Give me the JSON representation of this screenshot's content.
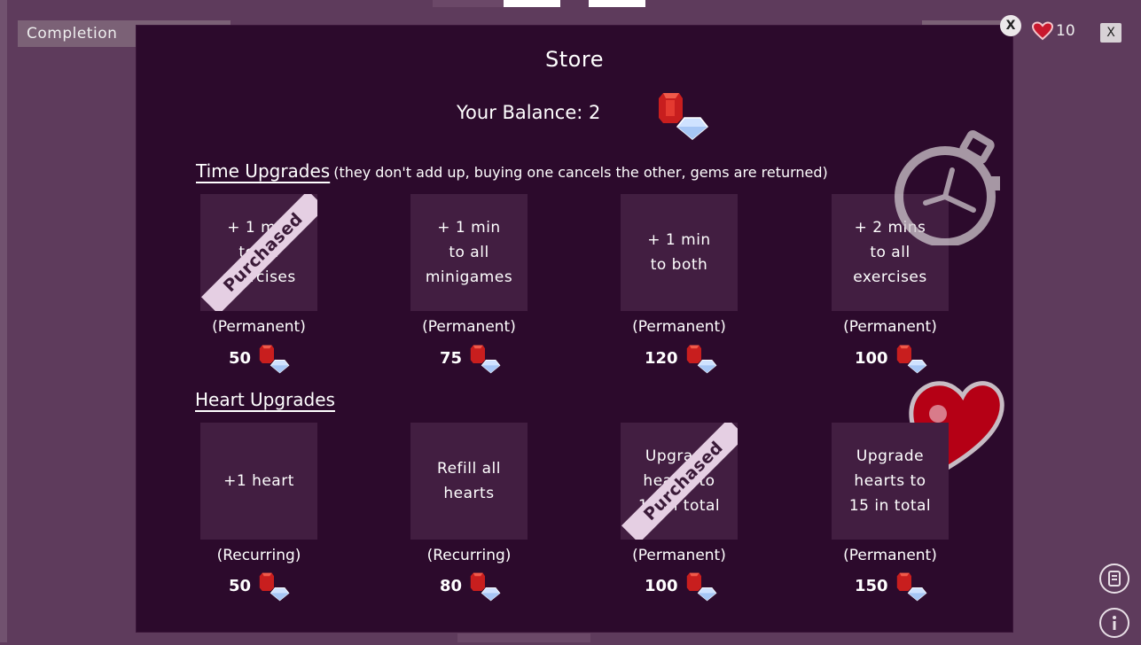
{
  "top_bar": {
    "completion_label": "Completion",
    "hearts_count": "10",
    "close_label": "X"
  },
  "store": {
    "close_label": "X",
    "title": "Store",
    "balance_label": "Your Balance: 2",
    "purchased_label": "Purchased",
    "time_section": {
      "title": "Time Upgrades",
      "note": "(they don't add up, buying one cancels the other, gems are returned)",
      "items": [
        {
          "label": "+ 1 min\nto all\nexercises",
          "type": "(Permanent)",
          "price": "50",
          "purchased": true
        },
        {
          "label": "+ 1 min\nto all\nminigames",
          "type": "(Permanent)",
          "price": "75",
          "purchased": false
        },
        {
          "label": "+ 1 min\nto both",
          "type": "(Permanent)",
          "price": "120",
          "purchased": false
        },
        {
          "label": "+ 2 mins\nto all\nexercises",
          "type": "(Permanent)",
          "price": "100",
          "purchased": false
        }
      ]
    },
    "heart_section": {
      "title": "Heart Upgrades",
      "items": [
        {
          "label": "+1 heart",
          "type": "(Recurring)",
          "price": "50",
          "purchased": false
        },
        {
          "label": "Refill all\nhearts",
          "type": "(Recurring)",
          "price": "80",
          "purchased": false
        },
        {
          "label": "Upgrade\nhearts to\n10 in total",
          "type": "(Permanent)",
          "price": "100",
          "purchased": true
        },
        {
          "label": "Upgrade\nhearts to\n15 in total",
          "type": "(Permanent)",
          "price": "150",
          "purchased": false
        }
      ]
    }
  },
  "icons": {
    "gem": "gem-icon",
    "stopwatch": "stopwatch-icon",
    "heart": "heart-icon",
    "scroll": "scroll-icon",
    "info": "info-icon"
  },
  "colors": {
    "panel_bg": "#2c0a2c",
    "card_bg": "#421e41",
    "page_bg": "#5e3b5c",
    "ribbon": "#e5cfe3",
    "heart_red": "#b50015"
  }
}
